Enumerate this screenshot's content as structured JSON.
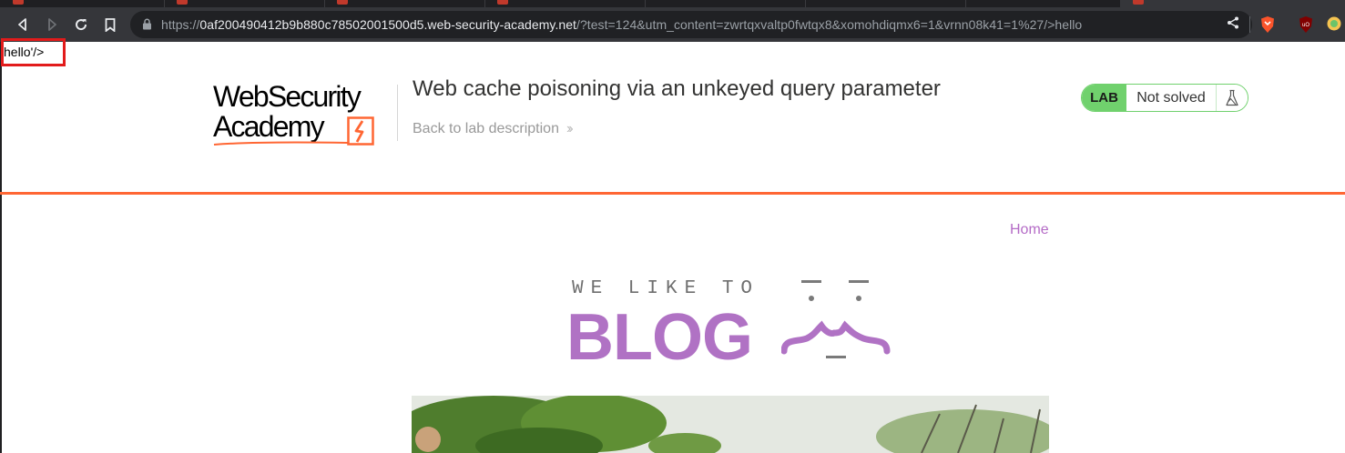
{
  "browser": {
    "url_scheme": "https://",
    "url_host": "0af200490412b9b880c78502001500d5.web-security-academy.net",
    "url_rest": "/?test=124&utm_content=zwrtqxvaltp0fwtqx8&xomohdiqmx6=1&vrnn08k41=1%27/>hello",
    "icons": [
      "back-icon",
      "forward-icon",
      "reload-icon",
      "bookmark-icon",
      "lock-icon",
      "share-icon",
      "brave-shield-icon",
      "ublock-icon",
      "extension-icon"
    ]
  },
  "reflected": {
    "text": "hello'/>"
  },
  "lab": {
    "logo_line1": "WebSecurity",
    "logo_line2": "Academy",
    "title": "Web cache poisoning via an unkeyed query parameter",
    "back_link": "Back to lab description",
    "status_tag": "LAB",
    "status_text": "Not solved"
  },
  "blog": {
    "nav_home": "Home",
    "tagline": "WE LIKE TO",
    "wordmark": "BLOG"
  },
  "colors": {
    "accent_orange": "#ff6633",
    "status_green": "#70d16d",
    "blog_purple": "#b072c4",
    "highlight_red": "#e21b1b"
  }
}
